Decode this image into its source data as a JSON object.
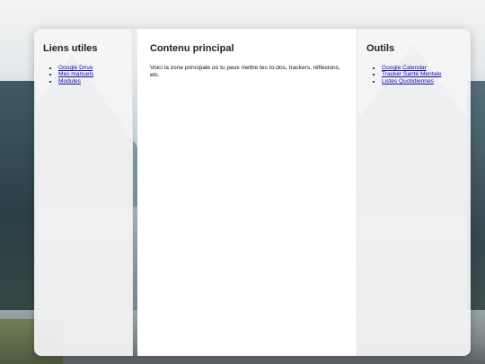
{
  "left_panel": {
    "title": "Liens utiles",
    "links": [
      "Google Drive",
      "Mes manuels",
      "Modules"
    ]
  },
  "main_panel": {
    "title": "Contenu principal",
    "text": "Voici la zone principale où tu peux mettre tes to-dos, trackers, réflexions, etc."
  },
  "right_panel": {
    "title": "Outils",
    "links": [
      "Google Calendar",
      "Tracker Santé Mentale",
      "Listes Quotidiennes"
    ]
  }
}
